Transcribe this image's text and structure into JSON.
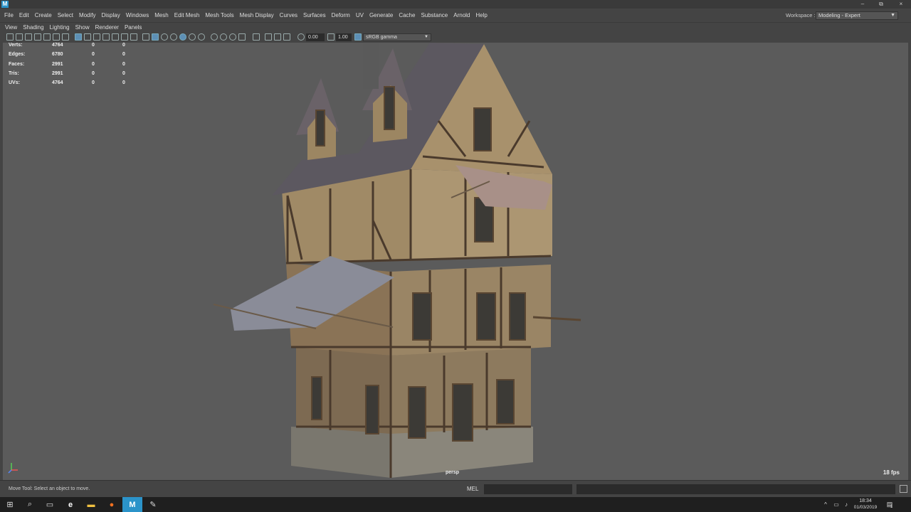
{
  "app": {
    "logo_letter": "M"
  },
  "window_controls": {
    "minimize": "–",
    "restore": "⧉",
    "close": "×"
  },
  "menu": [
    "File",
    "Edit",
    "Create",
    "Select",
    "Modify",
    "Display",
    "Windows",
    "Mesh",
    "Edit Mesh",
    "Mesh Tools",
    "Mesh Display",
    "Curves",
    "Surfaces",
    "Deform",
    "UV",
    "Generate",
    "Cache",
    "Substance",
    "Arnold",
    "Help"
  ],
  "workspace": {
    "label": "Workspace :",
    "value": "Modeling - Expert"
  },
  "panel_menu": [
    "View",
    "Shading",
    "Lighting",
    "Show",
    "Renderer",
    "Panels"
  ],
  "toolbar": {
    "exposure": "0.00",
    "gamma": "1.00",
    "colorspace": "sRGB gamma"
  },
  "hud": {
    "rows": [
      {
        "label": "Verts:",
        "v1": "4764",
        "v2": "0",
        "v3": "0"
      },
      {
        "label": "Edges:",
        "v1": "6780",
        "v2": "0",
        "v3": "0"
      },
      {
        "label": "Faces:",
        "v1": "2991",
        "v2": "0",
        "v3": "0"
      },
      {
        "label": "Tris:",
        "v1": "2991",
        "v2": "0",
        "v3": "0"
      },
      {
        "label": "UVs:",
        "v1": "4764",
        "v2": "0",
        "v3": "0"
      }
    ],
    "fps": "18 fps",
    "camera": "persp"
  },
  "status": {
    "help": "Move Tool: Select an object to move.",
    "mel_label": "MEL"
  },
  "taskbar": {
    "icons": [
      "windows-start",
      "search",
      "task-view",
      "edge",
      "file-explorer",
      "firefox",
      "maya",
      "substance"
    ],
    "time": "18:34",
    "date": "01/03/2019",
    "notification_count": "1"
  },
  "colors": {
    "viewport_bg": "#5b5b5b",
    "ui_bg": "#444444",
    "accent": "#2b93c9"
  }
}
